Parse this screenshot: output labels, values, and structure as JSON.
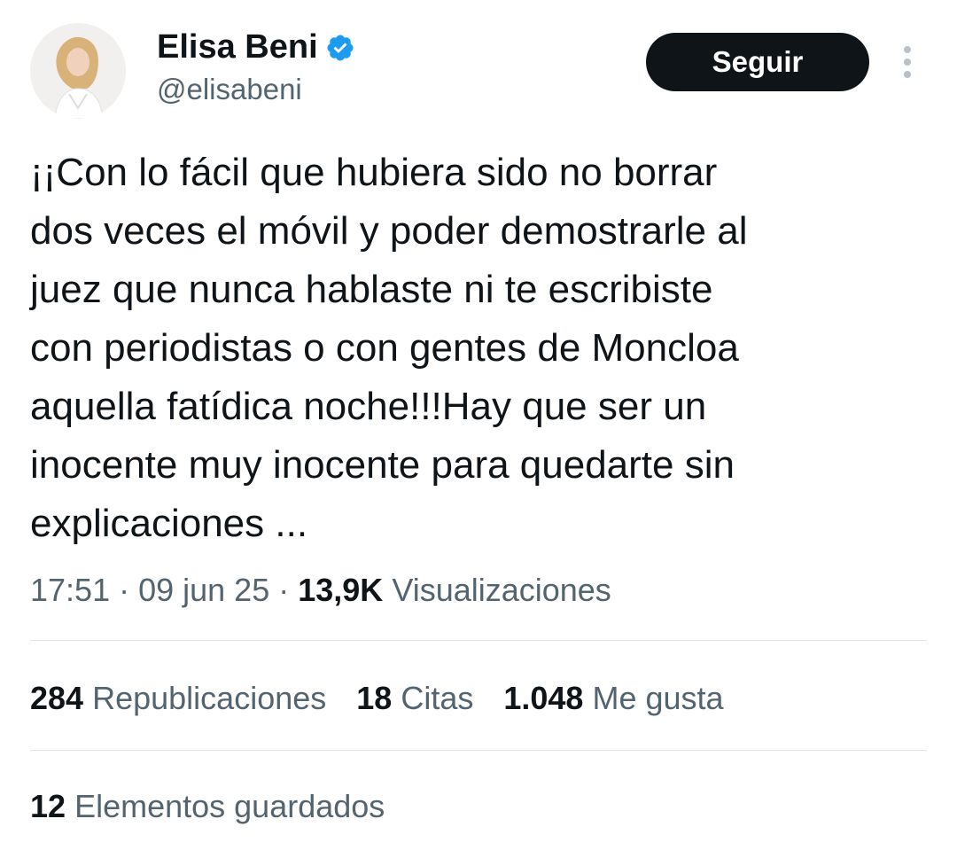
{
  "author": {
    "display_name": "Elisa Beni",
    "handle": "@elisabeni",
    "verified_icon": "verified-badge-icon",
    "verified_color": "#1d9bf0"
  },
  "header": {
    "follow_label": "Seguir",
    "more_icon": "more-vertical-icon"
  },
  "tweet": {
    "text": "¡¡Con lo fácil que hubiera sido no borrar\ndos veces el móvil y poder demostrarle al\njuez que nunca hablaste ni te escribiste\ncon periodistas o con gentes de Moncloa\naquella fatídica noche!!!Hay que ser un\ninocente muy inocente para quedarte sin\nexplicaciones ..."
  },
  "meta": {
    "time": "17:51",
    "separator": " · ",
    "date": "09 jun 25",
    "views_count": "13,9K",
    "views_label": "Visualizaciones"
  },
  "stats": {
    "reposts_count": "284",
    "reposts_label": "Republicaciones",
    "quotes_count": "18",
    "quotes_label": "Citas",
    "likes_count": "1.048",
    "likes_label": "Me gusta",
    "bookmarks_count": "12",
    "bookmarks_label": "Elementos guardados"
  },
  "colors": {
    "text_primary": "#0f1419",
    "text_secondary": "#536471",
    "divider": "#dfe3e6",
    "button_bg": "#0f1419"
  }
}
